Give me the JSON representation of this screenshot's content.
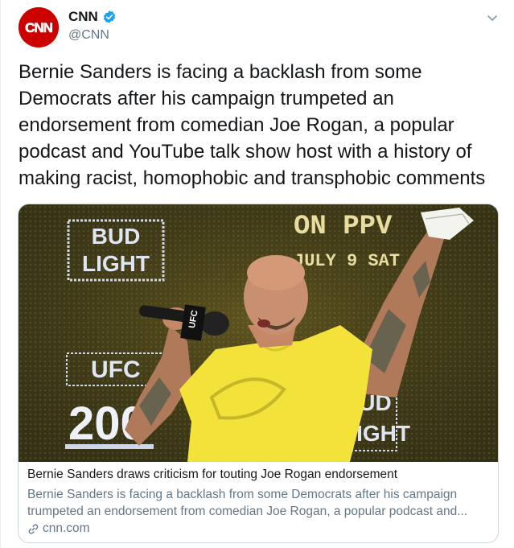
{
  "account": {
    "display_name": "CNN",
    "handle": "@CNN",
    "avatar_logo_text": "CNN",
    "verified": true
  },
  "tweet": {
    "text": "Bernie Sanders is facing a backlash from some Democrats after his campaign trumpeted an endorsement from comedian Joe Rogan, a popular podcast and YouTube talk show host with a history of making racist, homophobic and transphobic comments"
  },
  "card": {
    "title": "Bernie Sanders draws criticism for touting Joe Rogan endorsement",
    "description": "Bernie Sanders is facing a backlash from some Democrats after his campaign trumpeted an endorsement from comedian Joe Rogan, a popular podcast and...",
    "domain": "cnn.com",
    "image_text": {
      "sign_left_1": "BUD",
      "sign_left_2": "LIGHT",
      "sign_top_1": "ON PPV",
      "sign_top_2": "JULY 9 SAT",
      "sign_bottom_left_1": "UFC",
      "sign_bottom_left_2": "200",
      "sign_bottom_right_1": "BUD",
      "sign_bottom_right_2": "LIGHT",
      "mic_flag": "UFC"
    }
  },
  "colors": {
    "cnn_red": "#cc0000",
    "verified_blue": "#1da1f2",
    "secondary_text": "#657786",
    "border": "#ccd6dd"
  },
  "icons": {
    "verified": "verified-badge-icon",
    "menu": "chevron-down-icon",
    "link": "link-icon"
  }
}
